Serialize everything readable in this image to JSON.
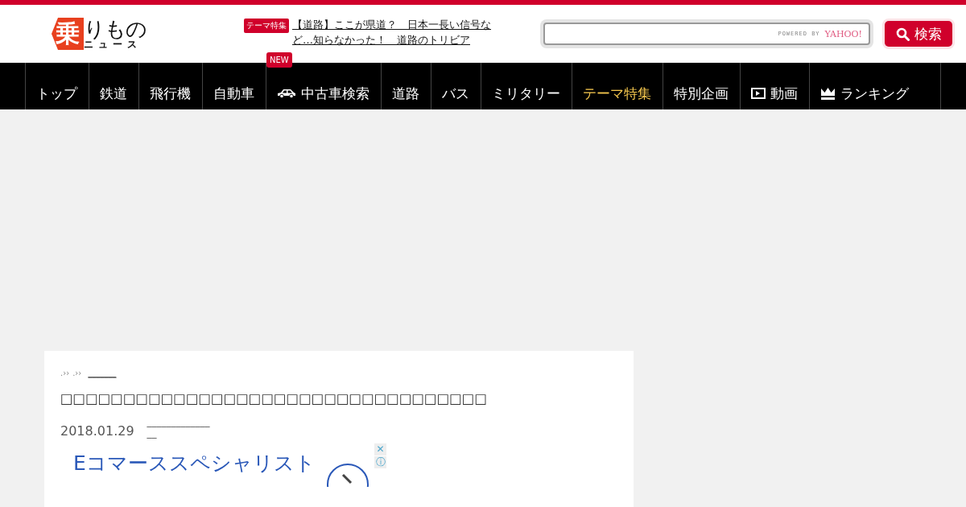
{
  "logo": {
    "mark": "乗",
    "name": "りもの",
    "sub": "ニュース"
  },
  "headline": {
    "badge": "テーマ特集",
    "text": "【道路】ここが県道？　日本一長い信号など…知らなかった！　道路のトリビア"
  },
  "search": {
    "powered": "POWERED BY",
    "brand": "YAHOO!",
    "button": "検索"
  },
  "nav": [
    {
      "label": "トップ",
      "kind": "text",
      "selected": false
    },
    {
      "label": "鉄道",
      "kind": "text",
      "selected": false
    },
    {
      "label": "飛行機",
      "kind": "text",
      "selected": false
    },
    {
      "label": "自動車",
      "kind": "text",
      "selected": false
    },
    {
      "label": "中古車検索",
      "kind": "car",
      "selected": false,
      "badge": "NEW"
    },
    {
      "label": "道路",
      "kind": "text",
      "selected": false
    },
    {
      "label": "バス",
      "kind": "text",
      "selected": false
    },
    {
      "label": "ミリタリー",
      "kind": "text",
      "selected": false
    },
    {
      "label": "テーマ特集",
      "kind": "text",
      "selected": true
    },
    {
      "label": "特別企画",
      "kind": "text",
      "selected": false
    },
    {
      "label": "動画",
      "kind": "video",
      "selected": false
    },
    {
      "label": "ランキング",
      "kind": "crown",
      "selected": false
    }
  ],
  "article": {
    "breadcrumb": [
      ".››",
      ".››"
    ],
    "breadcrumb_link": "_______",
    "title": "□□□□□□□□□□□□□□□□□□□□□□□□□□□□□□□□□□",
    "date": "2018.01.29",
    "meta": [
      "_____________",
      "__"
    ],
    "ad": {
      "title": "Eコマーススペシャリスト",
      "close": "✕",
      "info": "ⓘ"
    }
  }
}
